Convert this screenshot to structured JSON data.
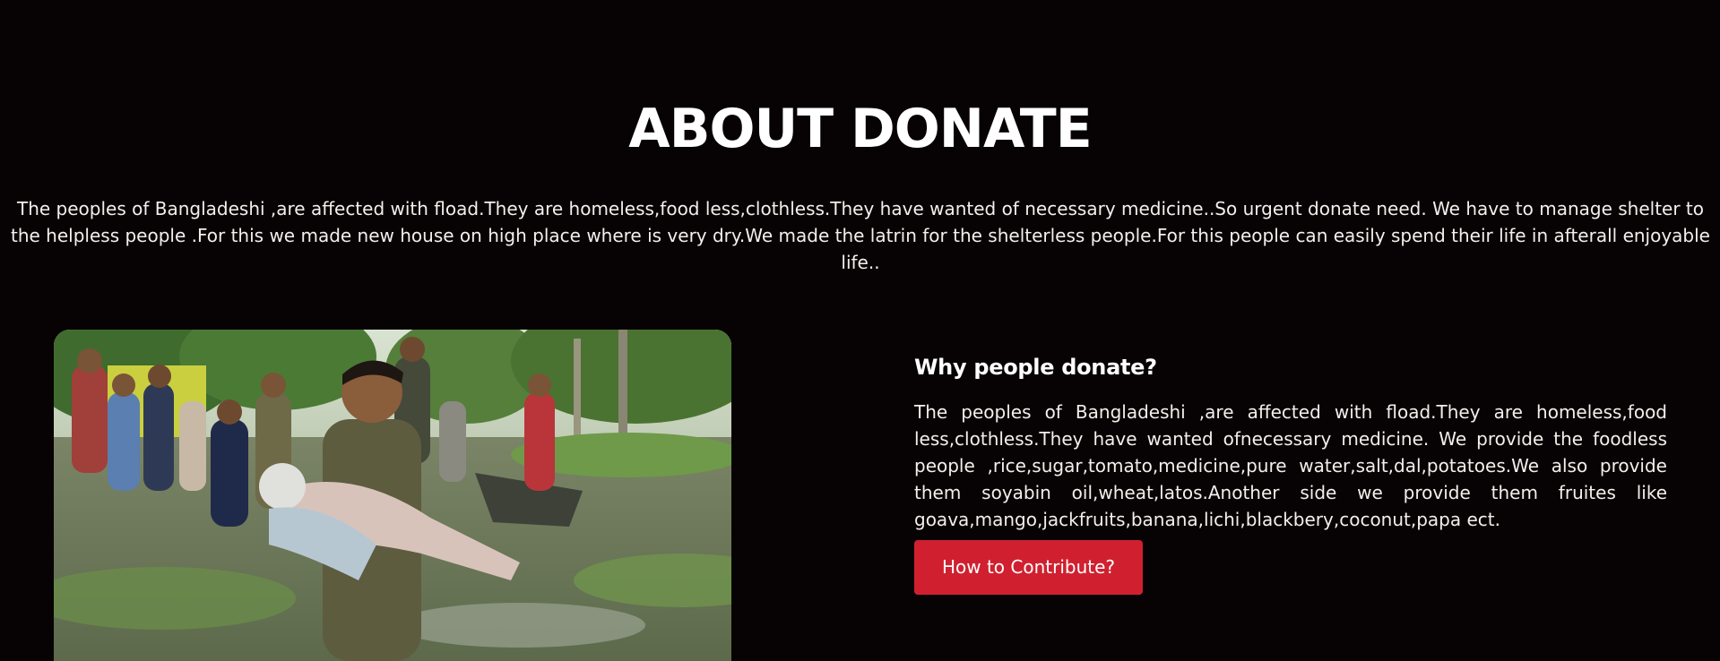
{
  "page": {
    "title": "ABOUT DONATE",
    "intro": "The peoples of Bangladeshi ,are affected with fload.They are homeless,food less,clothless.They have wanted of necessary medicine..So urgent donate need. We have to manage shelter to the helpless people .For this we made new house on high place where is very dry.We made the latrin for the shelterless people.For this people can easily spend their life in afterall enjoyable life.."
  },
  "why": {
    "heading": "Why people donate?",
    "text": "The peoples of Bangladeshi ,are affected with fload.They are homeless,food less,clothless.They have wanted ofnecessary medicine. We provide the foodless people ,rice,sugar,tomato,medicine,pure water,salt,dal,potatoes.We also provide them soyabin oil,wheat,latos.Another side we provide them fruites like goava,mango,jackfruits,banana,lichi,blackbery,coconut,papa ect.",
    "button_label": "How to Contribute?"
  },
  "colors": {
    "background": "#070203",
    "button": "#d0202f",
    "text": "#f4efec"
  }
}
